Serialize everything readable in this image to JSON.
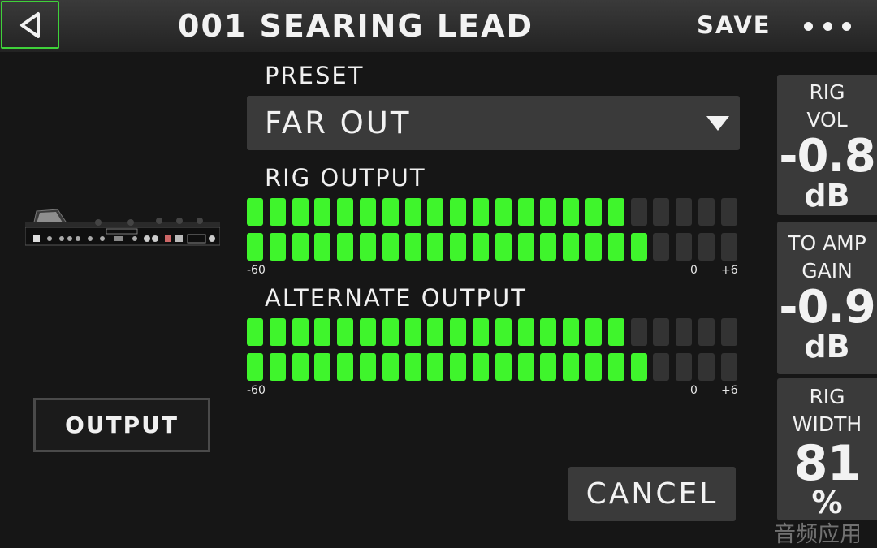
{
  "header": {
    "title": "001 SEARING LEAD",
    "save_label": "SAVE",
    "back_icon": "back-triangle-icon",
    "more_icon": "more-dots-icon"
  },
  "output_button": "OUTPUT",
  "preset": {
    "label": "PRESET",
    "value": "FAR OUT"
  },
  "rig_output": {
    "label": "RIG OUTPUT",
    "scale_min": "-60",
    "scale_zero": "0",
    "scale_max": "+6",
    "meters": [
      {
        "lit_segments": 17,
        "total_segments": 22
      },
      {
        "lit_segments": 18,
        "total_segments": 22
      }
    ]
  },
  "alternate_output": {
    "label": "ALTERNATE OUTPUT",
    "scale_min": "-60",
    "scale_zero": "0",
    "scale_max": "+6",
    "meters": [
      {
        "lit_segments": 17,
        "total_segments": 22
      },
      {
        "lit_segments": 18,
        "total_segments": 22
      }
    ]
  },
  "panels": {
    "rig_vol": {
      "label_line1": "RIG",
      "label_line2": "VOL",
      "value": "-0.8",
      "unit": "dB"
    },
    "to_amp_gain": {
      "label_line1": "TO AMP",
      "label_line2": "GAIN",
      "value": "-0.9",
      "unit": "dB"
    },
    "rig_width": {
      "label_line1": "RIG",
      "label_line2": "WIDTH",
      "value": "81",
      "unit": "%"
    }
  },
  "cancel_label": "CANCEL",
  "watermark": "音频应用",
  "colors": {
    "meter_on": "#3ff52c",
    "meter_off": "#333333",
    "back_border": "#3fd13a"
  }
}
